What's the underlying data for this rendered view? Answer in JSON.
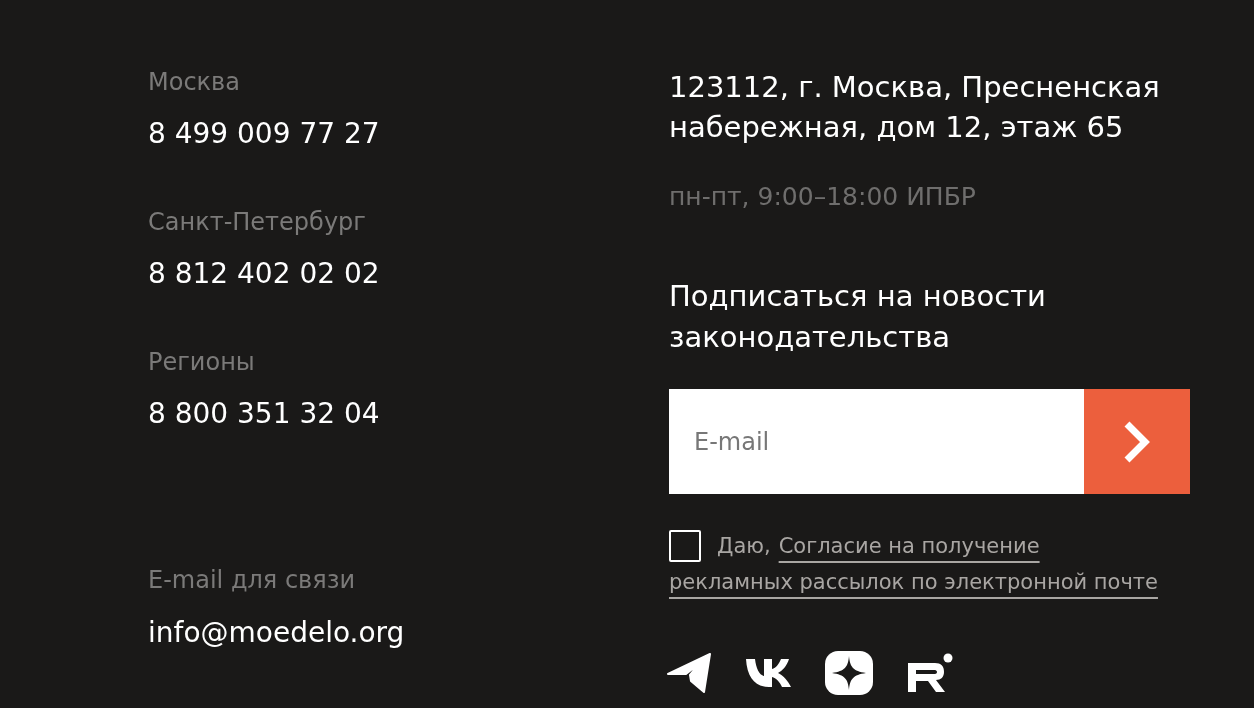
{
  "contacts": [
    {
      "label": "Москва",
      "phone": "8 499 009 77 27"
    },
    {
      "label": "Санкт-Петербург",
      "phone": "8 812 402 02 02"
    },
    {
      "label": "Регионы",
      "phone": "8 800 351 32 04"
    }
  ],
  "email_contact": {
    "label": "E-mail для связи",
    "email": "info@moedelo.org"
  },
  "address": "123112, г. Москва, Пресненская набережная, дом 12, этаж 65",
  "hours": "пн-пт, 9:00–18:00 ИПБР",
  "subscribe": {
    "heading": "Подписаться на новости законодательства",
    "email_field": {
      "placeholder": "E-mail"
    },
    "consent": {
      "checked": false,
      "prefix": "Даю,",
      "link_lines": [
        "Согласие на получение",
        "рекламных рассылок по электронной почте"
      ]
    }
  }
}
